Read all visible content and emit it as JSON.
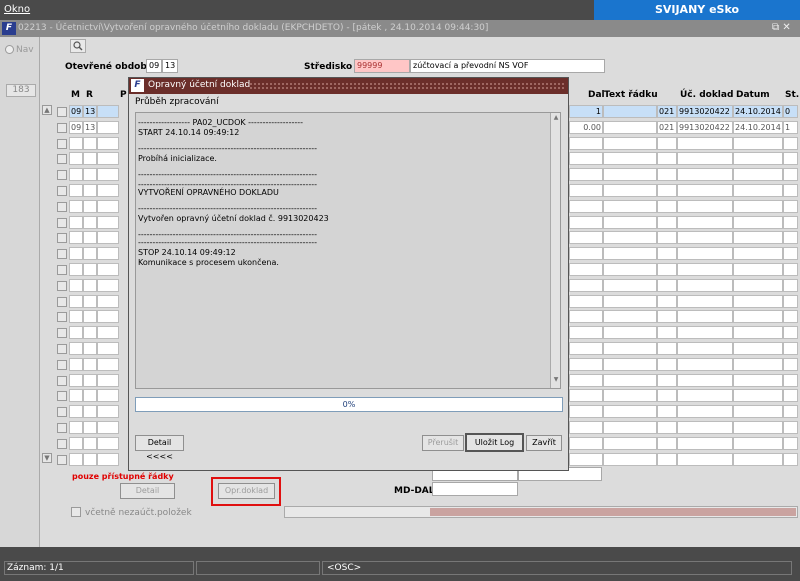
{
  "menu": {
    "okno": "Okno"
  },
  "brand": "SVIJANY eSko",
  "app": {
    "title": "02213 - Účetnictví\\Vytvoření opravného účetního dokladu (EKPCHDETO) - [pátek , 24.10.2014 09:44:30]",
    "window_buttons": "⧉ ✕"
  },
  "left": {
    "nav_label": "Nav",
    "count": "183"
  },
  "form": {
    "period_label": "Otevřené období",
    "period_month": "09",
    "period_year": "13",
    "center_label": "Středisko",
    "center_code": "99999",
    "center_name": "zúčtovací a převodní NS VOF"
  },
  "grid": {
    "headers": {
      "m": "M",
      "r": "R",
      "p": "P",
      "dal": "Dal",
      "text": "Text řádku",
      "uc": "Úč. doklad",
      "datum": "Datum",
      "st": "St."
    },
    "rows": [
      {
        "m": "09",
        "r": "13",
        "dal": "1 450.00",
        "code": "021",
        "doc": "9913020422",
        "date": "24.10.2014",
        "st": "0"
      },
      {
        "m": "09",
        "r": "13",
        "dal": "0.00",
        "code": "021",
        "doc": "9913020422",
        "date": "24.10.2014",
        "st": "1"
      }
    ]
  },
  "bottom": {
    "only_accessible": "pouze přístupné řádky",
    "detail": "Detail",
    "opr_doklad": "Opr.doklad",
    "md_dal": "MD-DAL",
    "include_unposted": "včetně nezaúčt.položek"
  },
  "dialog": {
    "title": "Opravný účetní doklad",
    "subtitle": "Průběh zpracování",
    "log": [
      "------------------ PA02_UCDOK -------------------",
      "START 24.10.14 09:49:12",
      "--------------------------------------------------------------",
      "Probíhá inicializace.",
      "--------------------------------------------------------------",
      "--------------------------------------------------------------",
      "VYTVOŘENÍ OPRAVNÉHO DOKLADU",
      "--------------------------------------------------------------",
      "Vytvořen opravný účetní doklad č. 9913020423",
      "--------------------------------------------------------------",
      "--------------------------------------------------------------",
      "STOP 24.10.14 09:49:12",
      "Komunikace s procesem ukončena."
    ],
    "progress": "0%",
    "progress_fraction": 0,
    "detail_btn": "Detail <<<<",
    "prerusit": "Přerušit",
    "ulozit_log": "Uložit Log",
    "zavrit": "Zavřít"
  },
  "status": {
    "zaznam": "Záznam: 1/1",
    "osc": "<OSC>"
  }
}
